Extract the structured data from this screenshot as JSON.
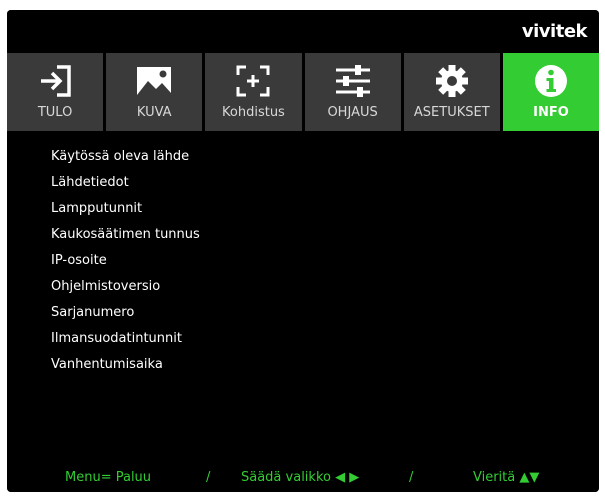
{
  "brand": {
    "logo": "vivitek"
  },
  "tabs": [
    {
      "label": "TULO",
      "icon": "input-icon"
    },
    {
      "label": "KUVA",
      "icon": "image-icon"
    },
    {
      "label": "Kohdistus",
      "icon": "alignment-icon"
    },
    {
      "label": "OHJAUS",
      "icon": "sliders-icon"
    },
    {
      "label": "ASETUKSET",
      "icon": "gear-icon"
    },
    {
      "label": "INFO",
      "icon": "info-icon",
      "active": true
    }
  ],
  "menu": {
    "items": [
      "Käytössä oleva lähde",
      "Lähdetiedot",
      "Lampputunnit",
      "Kaukosäätimen tunnus",
      "IP-osoite",
      "Ohjelmistoversio",
      "Sarjanumero",
      "Ilmansuodatintunnit",
      "Vanhentumisaika"
    ]
  },
  "footer": {
    "back": "Menu= Paluu",
    "sep1": "/",
    "adjust": "Säädä valikko ◀ ▶",
    "sep2": "/",
    "scroll": "Vieritä ▲▼"
  },
  "colors": {
    "accent": "#33cc33",
    "tab_bg": "#3a3a3a",
    "background": "#000000"
  }
}
